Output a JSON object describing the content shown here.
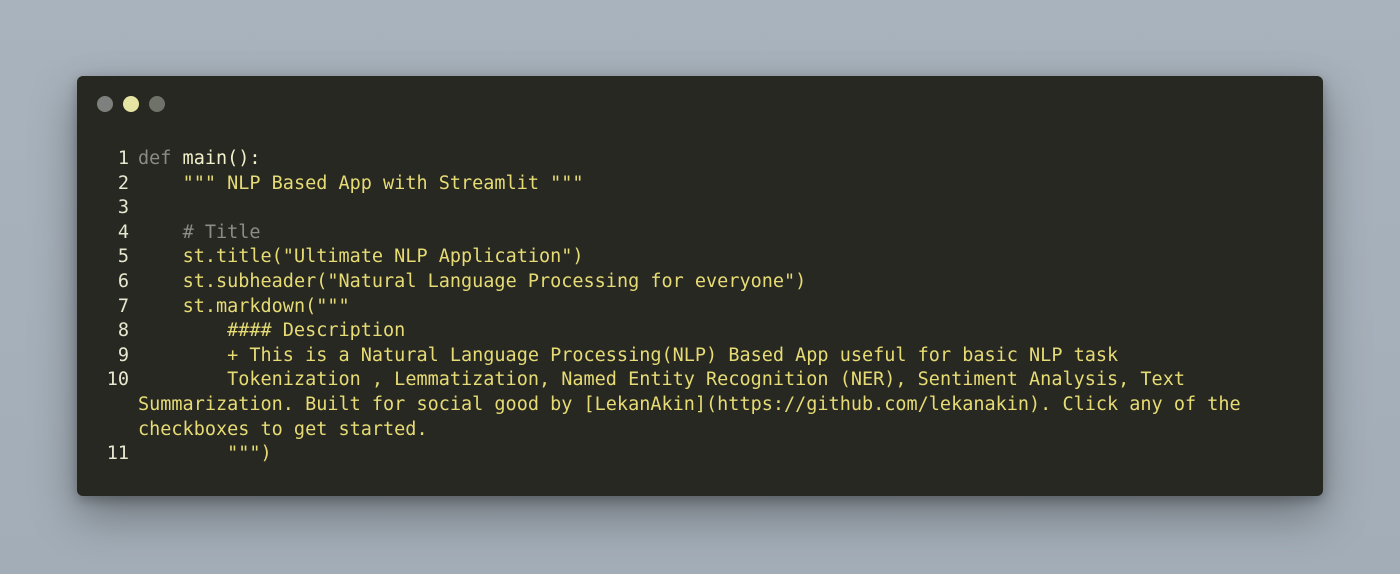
{
  "window": {
    "controls": [
      "close",
      "minimize",
      "maximize"
    ]
  },
  "code": {
    "lines": [
      {
        "number": "1",
        "keyword": "def",
        "text": " main():"
      },
      {
        "number": "2",
        "text": "    \"\"\" NLP Based App with Streamlit \"\"\""
      },
      {
        "number": "3",
        "text": ""
      },
      {
        "number": "4",
        "comment": "    # Title"
      },
      {
        "number": "5",
        "text": "    st.title(\"Ultimate NLP Application\")"
      },
      {
        "number": "6",
        "text": "    st.subheader(\"Natural Language Processing for everyone\")"
      },
      {
        "number": "7",
        "text": "    st.markdown(\"\"\""
      },
      {
        "number": "8",
        "text": "        #### Description"
      },
      {
        "number": "9",
        "text": "        + This is a Natural Language Processing(NLP) Based App useful for basic NLP task"
      },
      {
        "number": "10",
        "text": "        Tokenization , Lemmatization, Named Entity Recognition (NER), Sentiment Analysis, Text\nSummarization. Built for social good by [LekanAkin](https://github.com/lekanakin). Click any of the\ncheckboxes to get started."
      },
      {
        "number": "11",
        "text": "        \"\"\")"
      }
    ]
  }
}
